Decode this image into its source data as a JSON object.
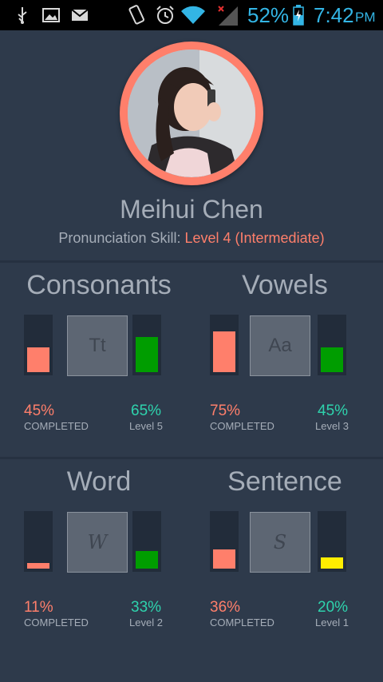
{
  "status_bar": {
    "battery": "52%",
    "time": "7:42",
    "ampm": "PM",
    "icons": [
      "usb-icon",
      "image-icon",
      "mail-icon",
      "vibrate-icon",
      "alarm-icon",
      "wifi-icon",
      "signal-icon",
      "battery-charging-icon"
    ]
  },
  "profile": {
    "name": "Meihui Chen",
    "skill_label": "Pronunciation Skill:",
    "skill_level": "Level 4 (Intermediate)",
    "ring_color": "#ff7f6b"
  },
  "colors": {
    "background": "#2e3a4b",
    "completed": "#ff7f6b",
    "level_text": "#2ed3ad",
    "level_bar_green": "#009d00",
    "level_bar_yellow": "#ffee00"
  },
  "cards": [
    {
      "title": "Consonants",
      "letter": "Tt",
      "completed_pct": "45%",
      "completed_label": "COMPLETED",
      "completed_value": 0.45,
      "level_pct": "65%",
      "level_label": "Level 5",
      "level_value": 0.65,
      "level_color": "#009d00"
    },
    {
      "title": "Vowels",
      "letter": "Aa",
      "completed_pct": "75%",
      "completed_label": "COMPLETED",
      "completed_value": 0.75,
      "level_pct": "45%",
      "level_label": "Level 3",
      "level_value": 0.45,
      "level_color": "#009d00"
    },
    {
      "title": "Word",
      "letter": "W",
      "completed_pct": "11%",
      "completed_label": "COMPLETED",
      "completed_value": 0.11,
      "level_pct": "33%",
      "level_label": "Level 2",
      "level_value": 0.33,
      "level_color": "#009d00"
    },
    {
      "title": "Sentence",
      "letter": "S",
      "completed_pct": "36%",
      "completed_label": "COMPLETED",
      "completed_value": 0.36,
      "level_pct": "20%",
      "level_label": "Level 1",
      "level_value": 0.2,
      "level_color": "#ffee00"
    }
  ]
}
